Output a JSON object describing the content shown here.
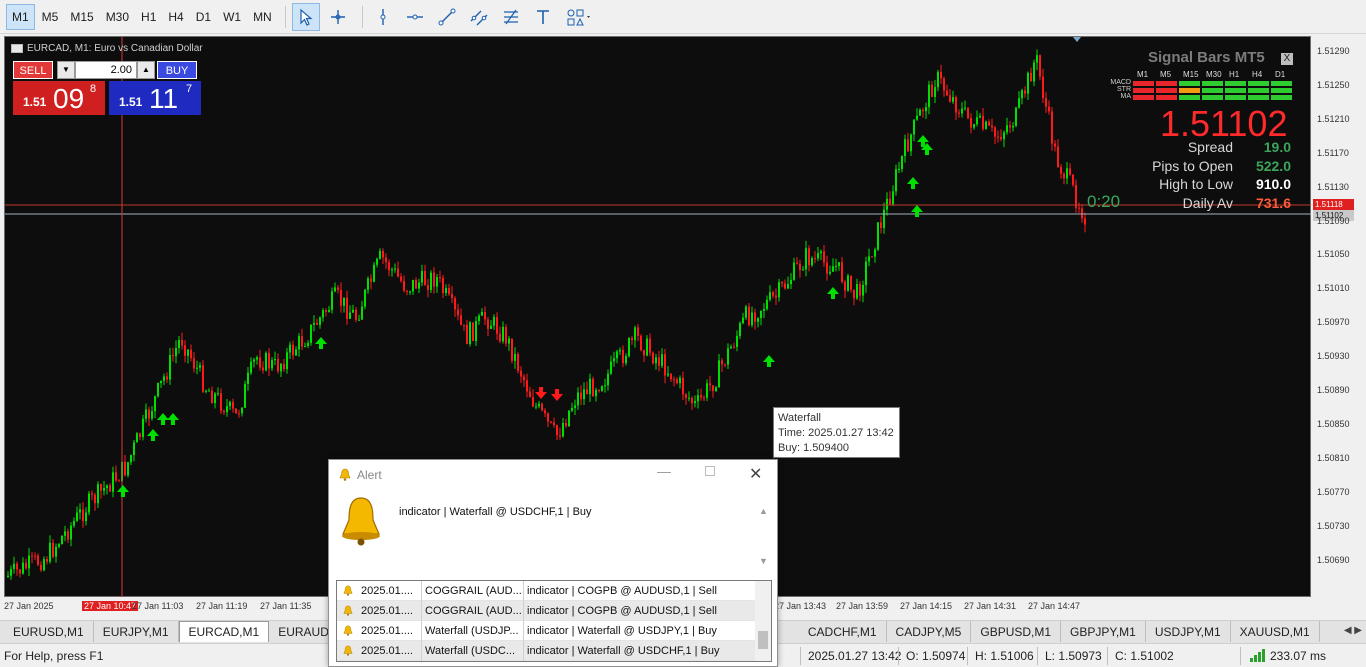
{
  "toolbar": {
    "timeframes": [
      "M1",
      "M5",
      "M15",
      "M30",
      "H1",
      "H4",
      "D1",
      "W1",
      "MN"
    ],
    "active_timeframe": "M1",
    "tools": [
      "cursor-icon",
      "crosshair-icon",
      "vertical-line-icon",
      "horizontal-line-icon",
      "trendline-icon",
      "channel-icon",
      "fibonacci-icon",
      "text-icon",
      "shapes-icon"
    ]
  },
  "chart": {
    "title": "EURCAD, M1:  Euro vs Canadian Dollar",
    "one_click": {
      "sell_label": "SELL",
      "buy_label": "BUY",
      "volume": "2.00",
      "sell_prefix": "1.51",
      "sell_big": "09",
      "sell_sup": "8",
      "buy_prefix": "1.51",
      "buy_big": "11",
      "buy_sup": "7"
    },
    "price_labels": [
      "1.51290",
      "1.51250",
      "1.51210",
      "1.51170",
      "1.51130",
      "1.51090",
      "1.51050",
      "1.51010",
      "1.50970",
      "1.50930",
      "1.50890",
      "1.50850",
      "1.50810",
      "1.50770",
      "1.50730",
      "1.50690"
    ],
    "ask_tag": "1.51118",
    "bid_tag": "1.51102",
    "time_labels": [
      "27 Jan 2025",
      "27 Jan 10:47",
      "27 Jan 11:03",
      "27 Jan 11:19",
      "27 Jan 11:35",
      "27 Jan 13:43",
      "27 Jan 13:59",
      "27 Jan 14:15",
      "27 Jan 14:31",
      "27 Jan 14:47"
    ],
    "crosshair_time": "27 Jan 10:47",
    "timer": "0:20",
    "tooltip": {
      "name": "Waterfall",
      "time": "Time: 2025.01.27 13:42",
      "value": "Buy: 1.509400"
    },
    "colors": {
      "up": "#00e000",
      "down": "#ff1a1a",
      "background": "#0d0d0d"
    }
  },
  "signal_bars": {
    "title": "Signal Bars MT5",
    "close_label": "X",
    "timeframes": [
      "M1",
      "M5",
      "M15",
      "M30",
      "H1",
      "H4",
      "D1"
    ],
    "rows": [
      {
        "label": "MACD",
        "states": [
          "red",
          "red",
          "green",
          "green",
          "green",
          "green",
          "green"
        ]
      },
      {
        "label": "STR",
        "states": [
          "red",
          "red",
          "orange",
          "green",
          "green",
          "green",
          "green"
        ]
      },
      {
        "label": "MA",
        "states": [
          "red",
          "red",
          "green",
          "green",
          "green",
          "green",
          "green"
        ]
      }
    ],
    "price": "1.51102",
    "stats": [
      {
        "label": "Spread",
        "value": "19.0",
        "color": "#3aa55b"
      },
      {
        "label": "Pips to Open",
        "value": "522.0",
        "color": "#3aa55b"
      },
      {
        "label": "High to Low",
        "value": "910.0",
        "color": "#ffffff"
      },
      {
        "label": "Daily Av",
        "value": "731.6",
        "color": "#ff5a3c"
      }
    ]
  },
  "tabs": [
    "EURUSD,M1",
    "EURJPY,M1",
    "EURCAD,M1",
    "EURAUD,M1",
    "",
    "",
    "",
    "",
    "",
    "CADCHF,M1",
    "CADJPY,M5",
    "GBPUSD,M1",
    "GBPJPY,M1",
    "USDJPY,M1",
    "XAUUSD,M1"
  ],
  "active_tab": "EURCAD,M1",
  "status": {
    "help": "For Help, press F1",
    "datetime": "2025.01.27 13:42",
    "open": "O: 1.50974",
    "high": "H: 1.51006",
    "low": "L: 1.50973",
    "close": "C: 1.51002",
    "ping": "233.07 ms"
  },
  "alert": {
    "title": "Alert",
    "message": "indicator | Waterfall @ USDCHF,1 | Buy",
    "rows": [
      {
        "time": "2025.01....",
        "source": "COGGRAIL (AUD...",
        "message": "indicator | COGPB @ AUDUSD,1 | Sell"
      },
      {
        "time": "2025.01....",
        "source": "COGGRAIL (AUD...",
        "message": "indicator | COGPB @ AUDUSD,1 | Sell"
      },
      {
        "time": "2025.01....",
        "source": "Waterfall (USDJP...",
        "message": "indicator | Waterfall @ USDJPY,1 | Buy"
      },
      {
        "time": "2025.01....",
        "source": "Waterfall (USDC...",
        "message": "indicator | Waterfall @ USDCHF,1 | Buy"
      }
    ]
  }
}
